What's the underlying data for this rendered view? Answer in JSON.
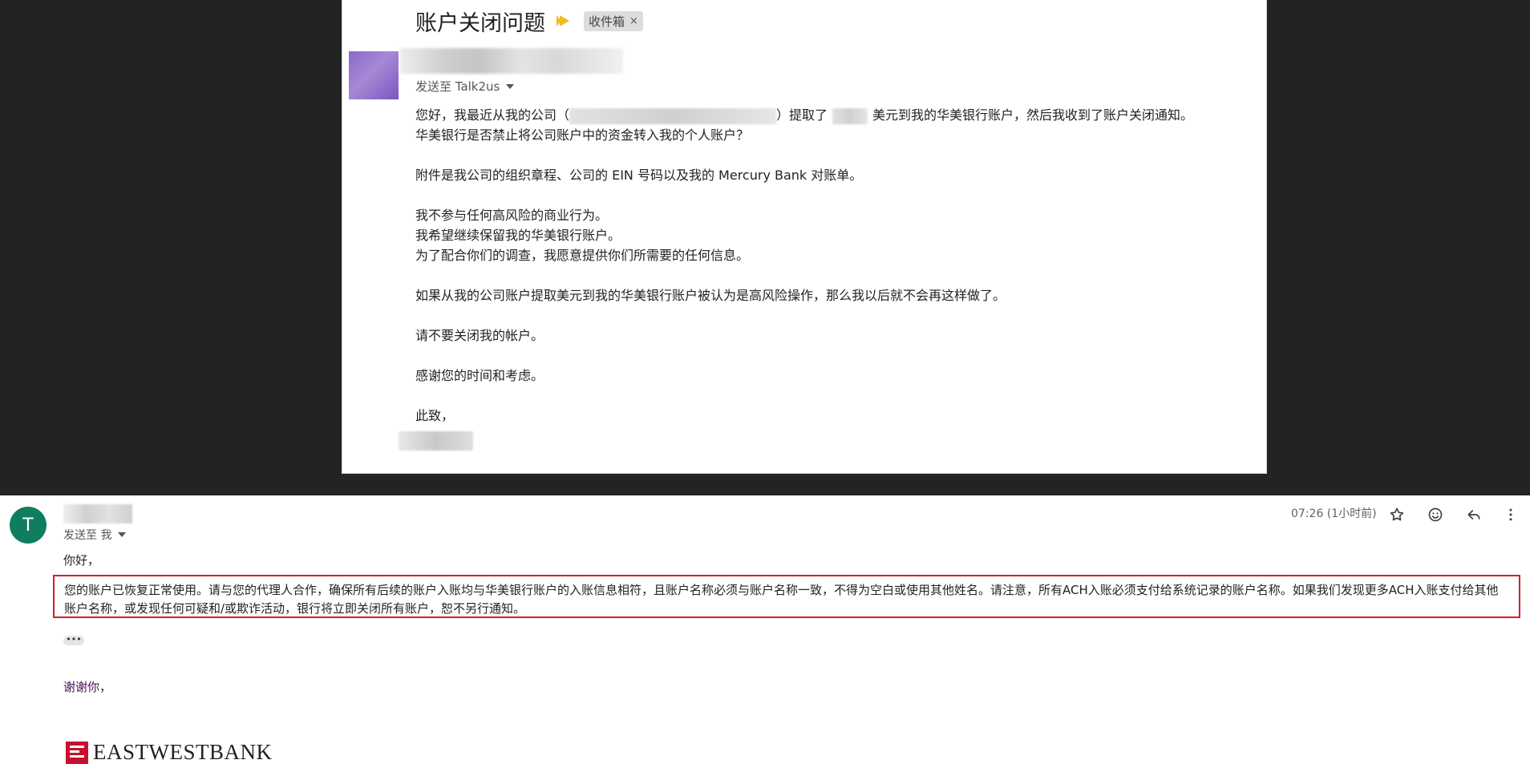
{
  "top_email": {
    "subject": "账户关闭问题",
    "label": "收件箱",
    "label_close": "×",
    "sent_to": "发送至 Talk2us",
    "body": {
      "p1_part1": "您好，我最近从我的公司（",
      "p1_part2": "）提取了",
      "p1_part3": "美元到我的华美银行账户，然后我收到了账户关闭通知。",
      "p1_line2": "华美银行是否禁止将公司账户中的资金转入我的个人账户？",
      "p2": "附件是我公司的组织章程、公司的 EIN 号码以及我的 Mercury Bank 对账单。",
      "p3_line1": "我不参与任何高风险的商业行为。",
      "p3_line2": "我希望继续保留我的华美银行账户。",
      "p3_line3": "为了配合你们的调查，我愿意提供你们所需要的任何信息。",
      "p4": "如果从我的公司账户提取美元到我的华美银行账户被认为是高风险操作，那么我以后就不会再这样做了。",
      "p5": "请不要关闭我的帐户。",
      "p6": "感谢您的时间和考虑。",
      "p7": "此致，"
    }
  },
  "reply_email": {
    "avatar_letter": "T",
    "sent_to": "发送至 我",
    "time": "07:26 (1小时前)",
    "greeting": "你好，",
    "notice": "您的账户已恢复正常使用。请与您的代理人合作，确保所有后续的账户入账均与华美银行账户的入账信息相符，且账户名称必须与账户名称一致，不得为空白或使用其他姓名。请注意，所有ACH入账必须支付给系统记录的账户名称。如果我们发现更多ACH入账支付给其他账户名称，或发现任何可疑和/或欺诈活动，银行将立即关闭所有账户，恕不另行通知。",
    "more": "•••",
    "thanks": "谢谢你，",
    "bank_name": "EASTWESTBANK",
    "icons": [
      "star-icon",
      "emoji-icon",
      "reply-icon",
      "more-vert-icon"
    ]
  },
  "colors": {
    "notice_border": "#d32027",
    "avatar_bg": "#0f7d5f",
    "bank_red": "#c8102e",
    "importance": "#f0bc26"
  }
}
